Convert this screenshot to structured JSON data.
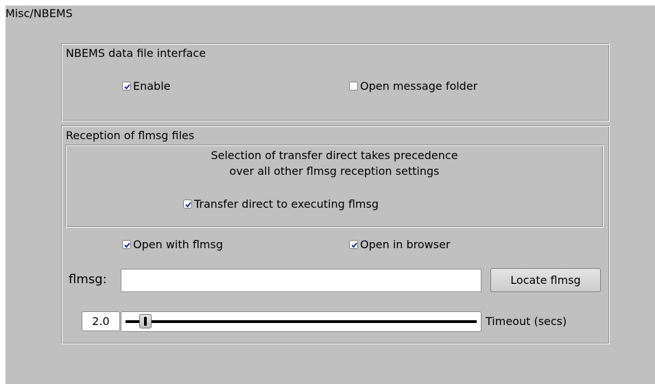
{
  "page": {
    "title": "Misc/NBEMS"
  },
  "nbems_group": {
    "label": "NBEMS data file interface",
    "enable": {
      "label": "Enable",
      "checked": true
    },
    "open_folder": {
      "label": "Open message folder",
      "checked": false
    }
  },
  "reception_group": {
    "label": "Reception of flmsg files",
    "info_line1": "Selection of transfer direct takes precedence",
    "info_line2": "over all other flmsg reception settings",
    "transfer_direct": {
      "label": "Transfer direct to executing flmsg",
      "checked": true
    },
    "open_with_flmsg": {
      "label": "Open with flmsg",
      "checked": true
    },
    "open_in_browser": {
      "label": "Open in browser",
      "checked": true
    },
    "flmsg_path": {
      "label": "flmsg:",
      "value": ""
    },
    "locate_button": "Locate flmsg",
    "timeout": {
      "value": "2.0",
      "label": "Timeout (secs)"
    }
  },
  "colors": {
    "panel_bg": "#c0c0c0",
    "check_mark": "#1a2a8a"
  },
  "icons": {
    "checkbox_checked": "checkmark-icon"
  }
}
